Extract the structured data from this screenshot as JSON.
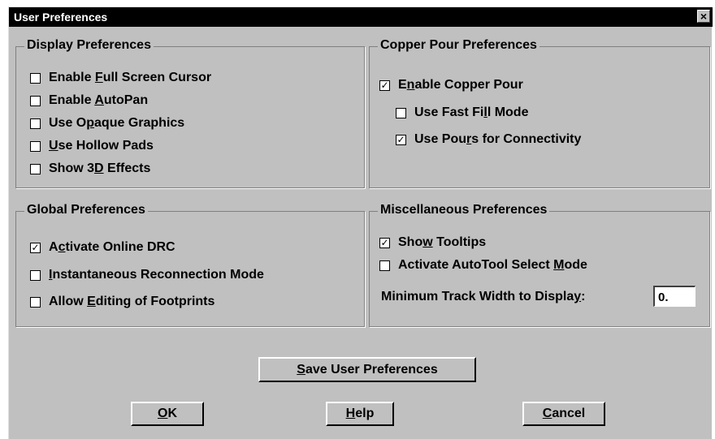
{
  "window": {
    "title": "User Preferences",
    "close_glyph": "×"
  },
  "display": {
    "title": "Display Preferences",
    "items": [
      {
        "pre": "Enable ",
        "acc": "F",
        "post": "ull Screen Cursor",
        "checked": false
      },
      {
        "pre": "Enable ",
        "acc": "A",
        "post": "utoPan",
        "checked": false
      },
      {
        "pre": "Use O",
        "acc": "p",
        "post": "aque Graphics",
        "checked": false
      },
      {
        "pre": "",
        "acc": "U",
        "post": "se Hollow Pads",
        "checked": false
      },
      {
        "pre": "Show 3",
        "acc": "D",
        "post": " Effects",
        "checked": false
      }
    ]
  },
  "copper": {
    "title": "Copper Pour Preferences",
    "items": [
      {
        "pre": "E",
        "acc": "n",
        "post": "able Copper Pour",
        "checked": true
      },
      {
        "pre": "Use Fast Fi",
        "acc": "l",
        "post": "l Mode",
        "checked": false
      },
      {
        "pre": "Use Pou",
        "acc": "r",
        "post": "s for Connectivity",
        "checked": true
      }
    ]
  },
  "global": {
    "title": "Global Preferences",
    "items": [
      {
        "pre": "A",
        "acc": "c",
        "post": "tivate Online DRC",
        "checked": true
      },
      {
        "pre": "",
        "acc": "I",
        "post": "nstantaneous Reconnection Mode",
        "checked": false
      },
      {
        "pre": "Allow ",
        "acc": "E",
        "post": "diting of Footprints",
        "checked": false
      }
    ]
  },
  "misc": {
    "title": "Miscellaneous Preferences",
    "items": [
      {
        "pre": "Sho",
        "acc": "w",
        "post": " Tooltips",
        "checked": true
      },
      {
        "pre": "Activate AutoTool Select ",
        "acc": "M",
        "post": "ode",
        "checked": false
      }
    ],
    "track_label": {
      "pre": "Minimum Track Width to Displa",
      "acc": "y",
      "post": ":"
    },
    "track_value": "0."
  },
  "buttons": {
    "save": {
      "pre": "",
      "acc": "S",
      "post": "ave User Preferences"
    },
    "ok": {
      "pre": "",
      "acc": "O",
      "post": "K"
    },
    "help": {
      "pre": "",
      "acc": "H",
      "post": "elp"
    },
    "cancel": {
      "pre": "",
      "acc": "C",
      "post": "ancel"
    }
  },
  "check_glyph": "✓"
}
